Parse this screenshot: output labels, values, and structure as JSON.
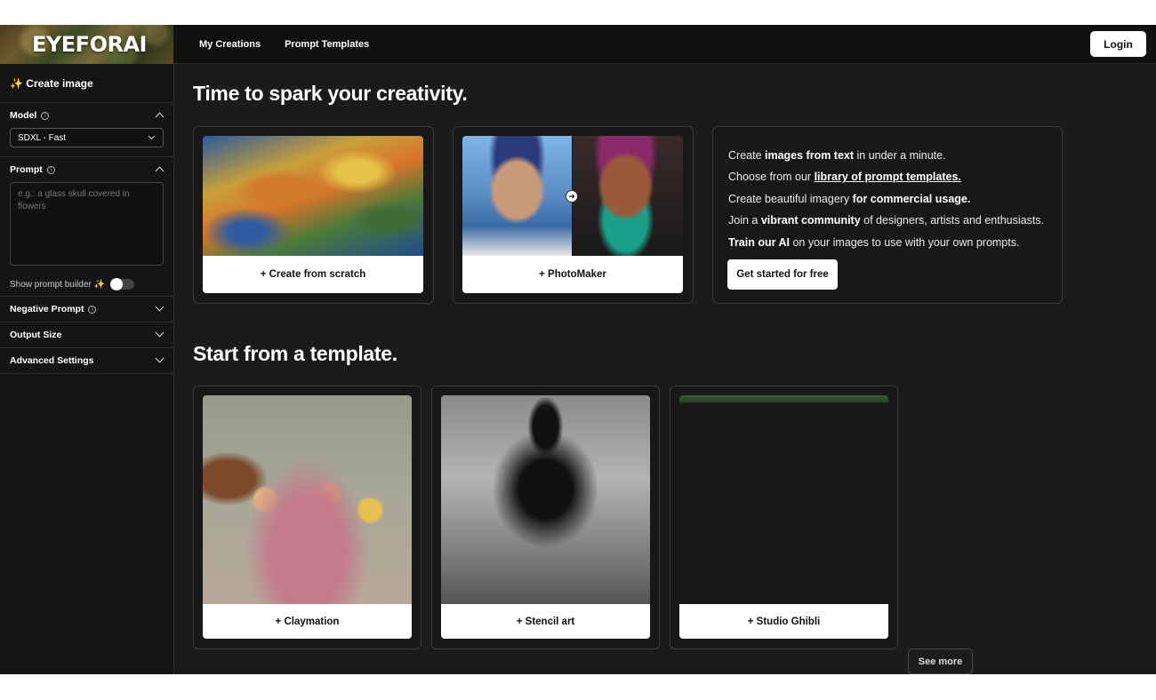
{
  "header": {
    "logo_text": "EYEFORAI",
    "nav": [
      "My Creations",
      "Prompt Templates"
    ],
    "login_label": "Login"
  },
  "sidebar": {
    "create_label": "✨ Create image",
    "model": {
      "label": "Model",
      "value": "SDXL - Fast"
    },
    "prompt": {
      "label": "Prompt",
      "placeholder": "e.g.: a glass skull covered in flowers"
    },
    "builder_label": "Show prompt builder ✨",
    "builder_on": false,
    "negative_label": "Negative Prompt",
    "output_label": "Output Size",
    "advanced_label": "Advanced Settings"
  },
  "main": {
    "hero_title": "Time to spark your creativity.",
    "scratch_label": "+ Create from scratch",
    "photomaker_label": "+ PhotoMaker",
    "info": {
      "line1": [
        "Create ",
        "images from text",
        " in under a minute."
      ],
      "line2": [
        "Choose from our ",
        "library of prompt templates."
      ],
      "line3": [
        "Create beautiful imagery ",
        "for commercial usage."
      ],
      "line4": [
        "Join a ",
        "vibrant community",
        " of designers, artists and enthusiasts."
      ],
      "line5": [
        "Train our AI",
        " on your images to use with your own prompts."
      ],
      "cta_label": "Get started for free"
    },
    "templates_title": "Start from a template.",
    "templates": [
      "+ Claymation",
      "+ Stencil art",
      "+ Studio Ghibli"
    ],
    "see_more_label": "See more"
  }
}
